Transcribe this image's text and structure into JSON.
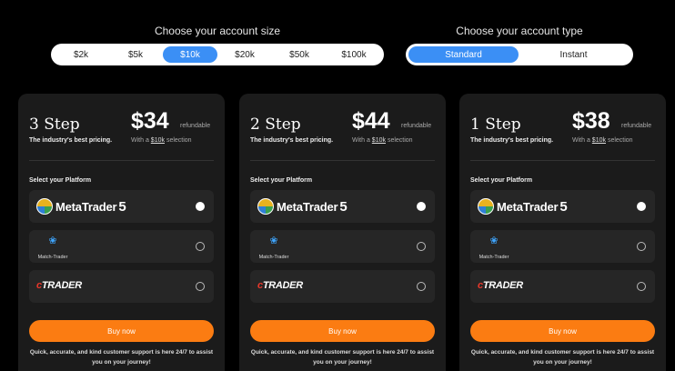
{
  "account_size": {
    "title": "Choose your account size",
    "options": [
      "$2k",
      "$5k",
      "$10k",
      "$20k",
      "$50k",
      "$100k"
    ],
    "selected": "$10k"
  },
  "account_type": {
    "title": "Choose your account type",
    "options": [
      "Standard",
      "Instant"
    ],
    "selected": "Standard"
  },
  "colors": {
    "accent": "#3b8ff5",
    "buy_button": "#fb7c12",
    "card_bg": "#1b1b1b"
  },
  "platform_label": "Select your Platform",
  "platforms": [
    {
      "name": "MetaTrader 5",
      "icon": "metatrader5-logo",
      "word": "MetaTrader",
      "number": "5"
    },
    {
      "name": "Match-Trader",
      "icon": "match-trader-logo",
      "word": "Match-Trader"
    },
    {
      "name": "cTrader",
      "icon": "ctrader-logo",
      "prefix": "c",
      "word": "TRADER"
    }
  ],
  "cards": [
    {
      "steps": "3 Step",
      "price": "$34",
      "refund": "refundable",
      "tagline": "The industry's best pricing.",
      "selection_prefix": "With a",
      "selection_value": "$10k",
      "selection_suffix": "selection",
      "selected_platform": "MetaTrader 5",
      "buy_label": "Buy now",
      "support": "Quick, accurate, and kind customer support is here 24/7 to assist you on your journey!"
    },
    {
      "steps": "2 Step",
      "price": "$44",
      "refund": "refundable",
      "tagline": "The industry's best pricing.",
      "selection_prefix": "With a",
      "selection_value": "$10k",
      "selection_suffix": "selection",
      "selected_platform": "MetaTrader 5",
      "buy_label": "Buy now",
      "support": "Quick, accurate, and kind customer support is here 24/7 to assist you on your journey!"
    },
    {
      "steps": "1 Step",
      "price": "$38",
      "refund": "refundable",
      "tagline": "The industry's best pricing.",
      "selection_prefix": "With a",
      "selection_value": "$10k",
      "selection_suffix": "selection",
      "selected_platform": "MetaTrader 5",
      "buy_label": "Buy now",
      "support": "Quick, accurate, and kind customer support is here 24/7 to assist you on your journey!"
    }
  ]
}
